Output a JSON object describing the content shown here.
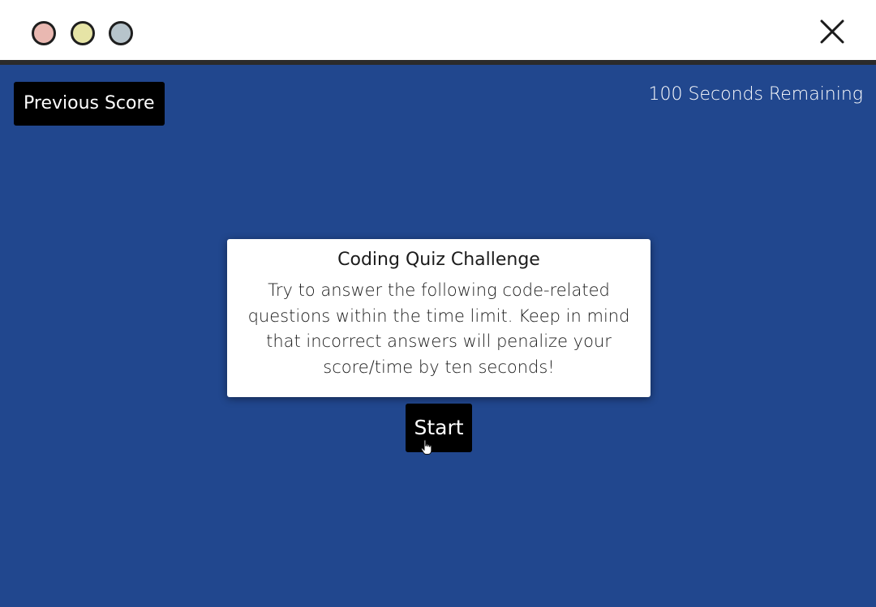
{
  "window": {
    "controls": [
      "red-dot",
      "yellow-dot",
      "gray-dot"
    ],
    "close_icon": "close-icon"
  },
  "header": {
    "previous_score_label": "Previous Score",
    "timer_text": "100 Seconds Remaining"
  },
  "intro_card": {
    "title": "Coding Quiz Challenge",
    "body": "Try to answer the following code-related questions within the time limit. Keep in mind that incorrect answers will penalize your score/time by ten seconds!"
  },
  "start_button": {
    "label": "Start"
  },
  "colors": {
    "background": "#21478e",
    "button_bg": "#000000",
    "button_text": "#ffffff",
    "card_bg": "#ffffff",
    "dot_red": "#e9b8b1",
    "dot_yellow": "#e6e4a6",
    "dot_gray": "#b7c4cb"
  }
}
